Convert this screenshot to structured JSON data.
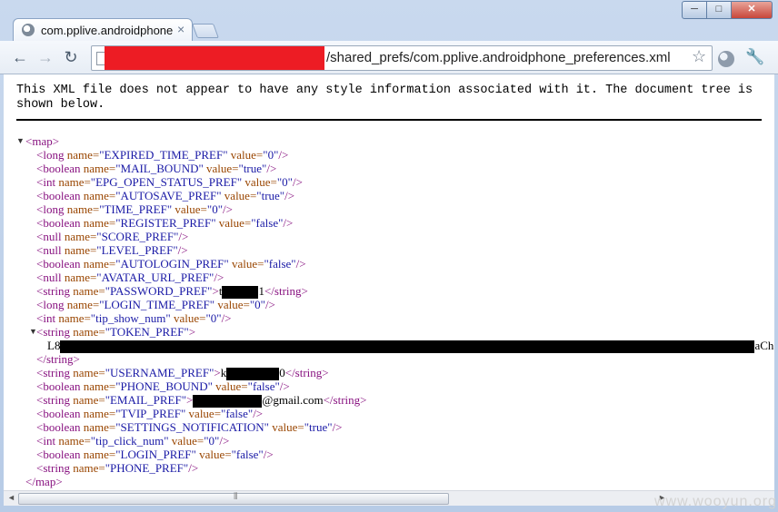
{
  "tab": {
    "title": "com.pplive.androidphone",
    "close": "×"
  },
  "window_controls": {
    "minimize": "─",
    "maximize": "□",
    "close": "✕"
  },
  "nav": {
    "back": "←",
    "forward": "→",
    "reload": "↻"
  },
  "address_bar": {
    "url_visible": "/shared_prefs/com.pplive.androidphone_preferences.xml",
    "star": "☆"
  },
  "wrench": "🔧",
  "notice": "This XML file does not appear to have any style information associated with it. The document tree is shown below.",
  "xml": {
    "map_open": "<map>",
    "map_close": "</map>",
    "lines": [
      {
        "tag": "<long",
        "attr": "name=",
        "name": "\"EXPIRED_TIME_PREF\"",
        "attr2": "value=",
        "value": "\"0\"",
        "end": "/>"
      },
      {
        "tag": "<boolean",
        "attr": "name=",
        "name": "\"MAIL_BOUND\"",
        "attr2": "value=",
        "value": "\"true\"",
        "end": "/>"
      },
      {
        "tag": "<int",
        "attr": "name=",
        "name": "\"EPG_OPEN_STATUS_PREF\"",
        "attr2": "value=",
        "value": "\"0\"",
        "end": "/>"
      },
      {
        "tag": "<boolean",
        "attr": "name=",
        "name": "\"AUTOSAVE_PREF\"",
        "attr2": "value=",
        "value": "\"true\"",
        "end": "/>"
      },
      {
        "tag": "<long",
        "attr": "name=",
        "name": "\"TIME_PREF\"",
        "attr2": "value=",
        "value": "\"0\"",
        "end": "/>"
      },
      {
        "tag": "<boolean",
        "attr": "name=",
        "name": "\"REGISTER_PREF\"",
        "attr2": "value=",
        "value": "\"false\"",
        "end": "/>"
      },
      {
        "tag": "<null",
        "attr": "name=",
        "name": "\"SCORE_PREF\"",
        "attr2": "",
        "value": "",
        "end": "/>"
      },
      {
        "tag": "<null",
        "attr": "name=",
        "name": "\"LEVEL_PREF\"",
        "attr2": "",
        "value": "",
        "end": "/>"
      },
      {
        "tag": "<boolean",
        "attr": "name=",
        "name": "\"AUTOLOGIN_PREF\"",
        "attr2": "value=",
        "value": "\"false\"",
        "end": "/>"
      },
      {
        "tag": "<null",
        "attr": "name=",
        "name": "\"AVATAR_URL_PREF\"",
        "attr2": "",
        "value": "",
        "end": "/>"
      },
      {
        "tag": "<string",
        "attr": "name=",
        "name": "\"PASSWORD_PREF\"",
        "attr2": "",
        "value": "",
        "end": ">",
        "text": "t",
        "text_after": "1",
        "close": "</string>"
      },
      {
        "tag": "<long",
        "attr": "name=",
        "name": "\"LOGIN_TIME_PREF\"",
        "attr2": "value=",
        "value": "\"0\"",
        "end": "/>"
      },
      {
        "tag": "<int",
        "attr": "name=",
        "name": "\"tip_show_num\"",
        "attr2": "value=",
        "value": "\"0\"",
        "end": "/>"
      }
    ],
    "token_open": {
      "tag": "<string",
      "attr": "name=",
      "name": "\"TOKEN_PREF\"",
      "end": ">"
    },
    "token_text_start": "L8",
    "token_text_end": "aCh",
    "token_close": "</string>",
    "lines2": [
      {
        "tag": "<string",
        "attr": "name=",
        "name": "\"USERNAME_PREF\"",
        "attr2": "",
        "value": "",
        "end": ">",
        "text": "k",
        "text_after": "0",
        "close": "</string>"
      },
      {
        "tag": "<boolean",
        "attr": "name=",
        "name": "\"PHONE_BOUND\"",
        "attr2": "value=",
        "value": "\"false\"",
        "end": "/>"
      },
      {
        "tag": "<string",
        "attr": "name=",
        "name": "\"EMAIL_PREF\"",
        "attr2": "",
        "value": "",
        "end": ">",
        "text": "",
        "text_after": "@gmail.com",
        "close": "</string>"
      },
      {
        "tag": "<boolean",
        "attr": "name=",
        "name": "\"TVIP_PREF\"",
        "attr2": "value=",
        "value": "\"false\"",
        "end": "/>"
      },
      {
        "tag": "<boolean",
        "attr": "name=",
        "name": "\"SETTINGS_NOTIFICATION\"",
        "attr2": "value=",
        "value": "\"true\"",
        "end": "/>"
      },
      {
        "tag": "<int",
        "attr": "name=",
        "name": "\"tip_click_num\"",
        "attr2": "value=",
        "value": "\"0\"",
        "end": "/>"
      },
      {
        "tag": "<boolean",
        "attr": "name=",
        "name": "\"LOGIN_PREF\"",
        "attr2": "value=",
        "value": "\"false\"",
        "end": "/>"
      },
      {
        "tag": "<string",
        "attr": "name=",
        "name": "\"PHONE_PREF\"",
        "attr2": "",
        "value": "",
        "end": "/>"
      }
    ]
  },
  "scrollbar": {
    "left": "◄",
    "right": "►",
    "grip": "⦀"
  },
  "watermark": "www.wooyun.org"
}
